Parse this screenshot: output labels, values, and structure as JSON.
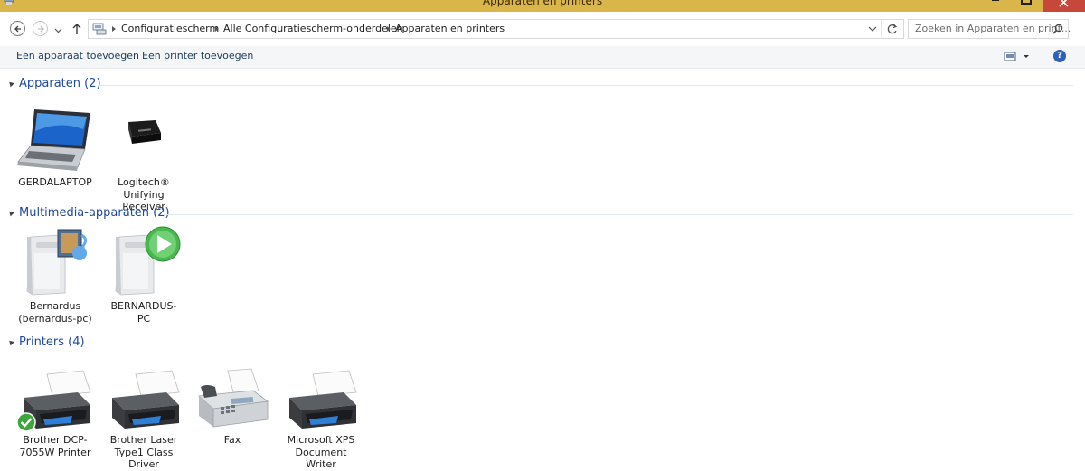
{
  "window": {
    "title": "Apparaten en printers"
  },
  "addressbar": {
    "breadcrumbs": [
      "Configuratiescherm",
      "Alle Configuratiescherm-onderdelen",
      "Apparaten en printers"
    ],
    "search_placeholder": "Zoeken in Apparaten en print..."
  },
  "commandbar": {
    "add_device": "Een apparaat toevoegen",
    "add_printer": "Een printer toevoegen",
    "help": "?"
  },
  "sections": [
    {
      "label": "Apparaten (2)",
      "items": [
        {
          "name": "GERDALAPTOP",
          "icon": "laptop-icon"
        },
        {
          "name": "Logitech® Unifying Receiver",
          "icon": "usb-receiver-icon"
        }
      ]
    },
    {
      "label": "Multimedia-apparaten (2)",
      "items": [
        {
          "name": "Bernardus (bernardus-pc)",
          "icon": "media-server-icon"
        },
        {
          "name": "BERNARDUS-PC",
          "icon": "media-player-icon"
        }
      ]
    },
    {
      "label": "Printers (4)",
      "items": [
        {
          "name": "Brother DCP-7055W Printer",
          "icon": "printer-icon",
          "default": true
        },
        {
          "name": "Brother Laser Type1 Class Driver",
          "icon": "printer-icon"
        },
        {
          "name": "Fax",
          "icon": "fax-icon"
        },
        {
          "name": "Microsoft XPS Document Writer",
          "icon": "printer-icon"
        }
      ]
    }
  ],
  "colors": {
    "titlebar": "#d9b54a",
    "close": "#c7483b",
    "section_header": "#1e4aa0",
    "command_text": "#1e395b"
  }
}
